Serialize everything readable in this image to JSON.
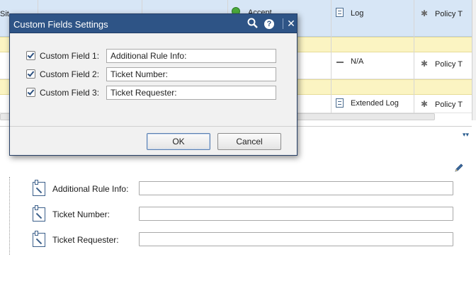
{
  "table": {
    "rows": [
      {
        "site_fragment": "Sit",
        "action": "Accept",
        "track": "Log",
        "installed_on": "Policy T"
      },
      {
        "site_fragment": "",
        "action": "",
        "track": "N/A",
        "installed_on": "Policy T"
      },
      {
        "site_fragment": "",
        "action": "",
        "track": "Extended Log",
        "installed_on": "Policy T"
      }
    ]
  },
  "dialog": {
    "title": "Custom Fields Settings",
    "search_icon": "search-icon",
    "help_glyph": "?",
    "close_glyph": "✕",
    "fields": [
      {
        "label": "Custom Field 1:",
        "value": "Additional Rule Info:",
        "checked": true
      },
      {
        "label": "Custom Field 2:",
        "value": "Ticket Number:",
        "checked": true
      },
      {
        "label": "Custom Field 3:",
        "value": "Ticket Requester:",
        "checked": true
      }
    ],
    "ok_label": "OK",
    "cancel_label": "Cancel"
  },
  "pane": {
    "collapse_glyph": "▾▾",
    "edit_icon": "pencil-icon",
    "fields": [
      {
        "label": "Additional Rule Info:",
        "value": ""
      },
      {
        "label": "Ticket Number:",
        "value": ""
      },
      {
        "label": "Ticket Requester:",
        "value": ""
      }
    ]
  },
  "colors": {
    "dialog_title_bar": "#2e5486",
    "selected_row": "#d7e6f6",
    "section_row": "#fbf4c2"
  }
}
